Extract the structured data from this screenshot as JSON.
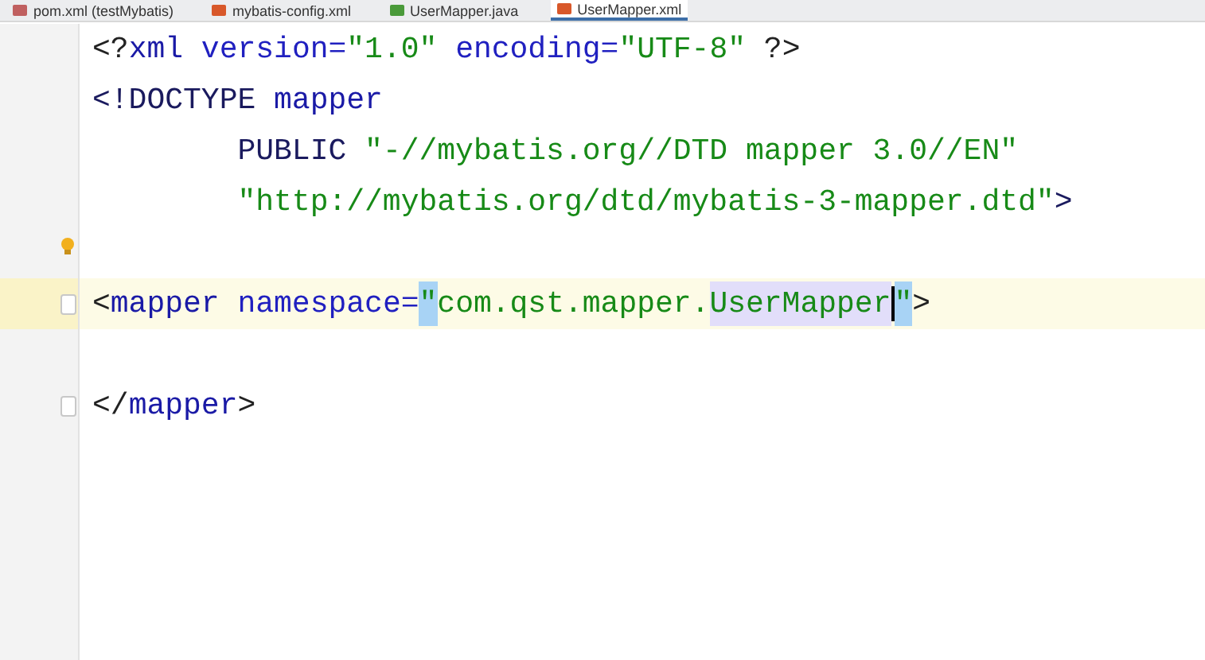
{
  "tabs": [
    {
      "label": "pom.xml (testMybatis)",
      "kind": "maven",
      "selected": false
    },
    {
      "label": "mybatis-config.xml",
      "kind": "xml",
      "selected": false
    },
    {
      "label": "UserMapper.java",
      "kind": "java",
      "selected": false
    },
    {
      "label": "UserMapper.xml",
      "kind": "xml",
      "selected": true
    }
  ],
  "lines": [
    {
      "current": false,
      "fold": false,
      "bulb": false,
      "tokens": [
        {
          "text": "<?",
          "kind": "punct"
        },
        {
          "text": "xml",
          "kind": "name"
        },
        {
          "text": " version",
          "kind": "attr"
        },
        {
          "text": "=",
          "kind": "attr"
        },
        {
          "text": "\"1.0\"",
          "kind": "string"
        },
        {
          "text": " encoding",
          "kind": "attr"
        },
        {
          "text": "=",
          "kind": "attr"
        },
        {
          "text": "\"UTF-8\"",
          "kind": "string"
        },
        {
          "text": " ?>",
          "kind": "punct"
        }
      ]
    },
    {
      "current": false,
      "fold": false,
      "bulb": false,
      "tokens": [
        {
          "text": "<!DOCTYPE",
          "kind": "keyword"
        },
        {
          "text": " mapper",
          "kind": "name"
        }
      ]
    },
    {
      "current": false,
      "fold": false,
      "bulb": false,
      "tokens": [
        {
          "text": "        PUBLIC",
          "kind": "keyword"
        },
        {
          "text": " \"-//mybatis.org//DTD mapper 3.0//EN\"",
          "kind": "string"
        }
      ]
    },
    {
      "current": false,
      "fold": false,
      "bulb": false,
      "tokens": [
        {
          "text": "        \"http://mybatis.org/dtd/mybatis-3-mapper.dtd\"",
          "kind": "string"
        },
        {
          "text": ">",
          "kind": "keyword"
        }
      ]
    },
    {
      "current": false,
      "fold": false,
      "bulb": true
    },
    {
      "current": true,
      "fold": true,
      "bulb": false,
      "tokens": [
        {
          "text": "<",
          "kind": "punct",
          "matched": false,
          "selected": false
        },
        {
          "text": "mapper",
          "kind": "name",
          "matched": false,
          "selected": false
        },
        {
          "text": " namespace",
          "kind": "attr",
          "matched": false,
          "selected": false
        },
        {
          "text": "=",
          "kind": "attr",
          "matched": false,
          "selected": false
        },
        {
          "text": "\"",
          "kind": "string",
          "matched": true,
          "selected": false
        },
        {
          "text": "com.qst.mapper.",
          "kind": "string",
          "matched": false,
          "selected": false
        },
        {
          "text": "UserMapper",
          "kind": "string",
          "matched": false,
          "selected": true
        },
        {
          "kind": "caret"
        },
        {
          "text": "\"",
          "kind": "string",
          "matched": true,
          "selected": false
        },
        {
          "text": ">",
          "kind": "punct",
          "matched": false,
          "selected": false
        }
      ]
    },
    {
      "current": false,
      "fold": false,
      "bulb": false
    },
    {
      "current": false,
      "fold": true,
      "bulb": false,
      "tokens": [
        {
          "text": "</",
          "kind": "punct"
        },
        {
          "text": "mapper",
          "kind": "name"
        },
        {
          "text": ">",
          "kind": "punct"
        }
      ]
    }
  ]
}
